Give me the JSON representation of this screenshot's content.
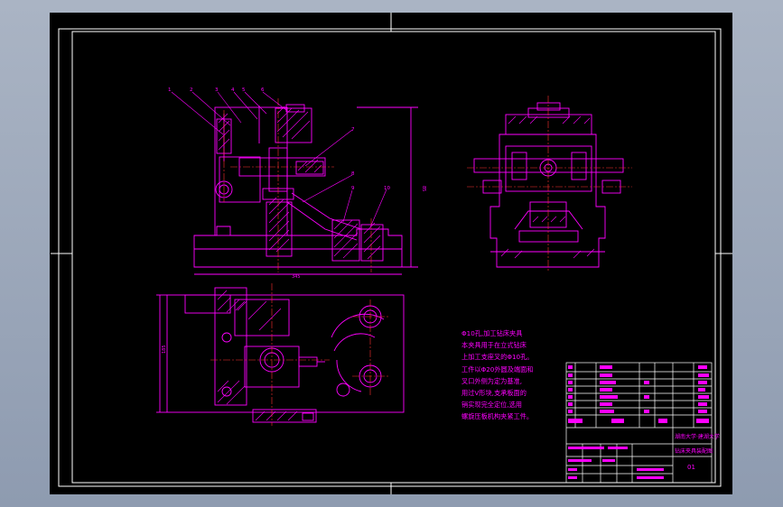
{
  "colors": {
    "background": "#000000",
    "frame": "#ffffff",
    "geometry": "#ff00ff",
    "centerline": "#ff3030",
    "window_bg": "#97a3b7"
  },
  "part_numbers": [
    "1",
    "2",
    "3",
    "4",
    "5",
    "6",
    "7",
    "8",
    "9",
    "10"
  ],
  "dimensions": {
    "width_front": "345",
    "height_front": "85",
    "width_plan": "185"
  },
  "note_lines": [
    "Φ10孔,加工钻床夹具",
    "本夹具用于在立式钻床",
    "上加工支座叉的Φ10孔。",
    "工件以Φ20外圆及端面和",
    "叉口外侧为定为基准,",
    "用过V形块,支承板面的",
    "销实现完全定位,选用",
    "螺旋压板机构夹紧工件。"
  ],
  "title_block": {
    "university": "湖南大学·建湖大学",
    "drawing_name": "钻床夹具装配图",
    "sheet_code": "01"
  }
}
